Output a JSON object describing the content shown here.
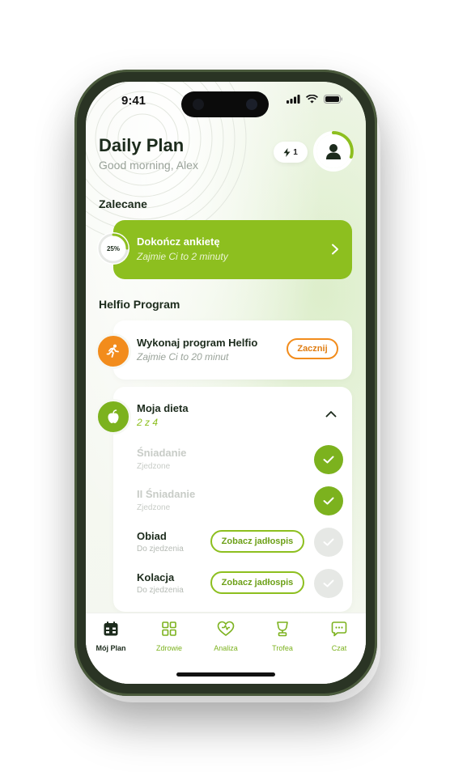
{
  "status_bar": {
    "time": "9:41"
  },
  "header": {
    "title": "Daily Plan",
    "greeting": "Good morning, Alex",
    "streak_count": "1"
  },
  "recommended": {
    "section_title": "Zalecane",
    "card": {
      "progress": "25%",
      "progress_fraction": 0.25,
      "title": "Dokończ ankietę",
      "subtitle": "Zajmie Ci to 2 minuty"
    }
  },
  "program": {
    "section_title": "Helfio Program",
    "task": {
      "title": "Wykonaj program Helfio",
      "subtitle": "Zajmie Ci to 20 minut",
      "button_label": "Zacznij"
    },
    "diet": {
      "title": "Moja dieta",
      "progress_text": "2 z 4",
      "meals": [
        {
          "name": "Śniadanie",
          "status": "Zjedzone",
          "done": true
        },
        {
          "name": "II Śniadanie",
          "status": "Zjedzone",
          "done": true
        },
        {
          "name": "Obiad",
          "status": "Do zjedzenia",
          "done": false,
          "button_label": "Zobacz jadłospis"
        },
        {
          "name": "Kolacja",
          "status": "Do zjedzenia",
          "done": false,
          "button_label": "Zobacz jadłospis"
        }
      ]
    }
  },
  "tabbar": {
    "items": [
      {
        "label": "Mój Plan",
        "icon": "calendar-icon",
        "active": true
      },
      {
        "label": "Zdrowie",
        "icon": "grid-icon",
        "active": false
      },
      {
        "label": "Analiza",
        "icon": "heart-icon",
        "active": false
      },
      {
        "label": "Trofea",
        "icon": "trophy-icon",
        "active": false
      },
      {
        "label": "Czat",
        "icon": "chat-icon",
        "active": false
      }
    ]
  },
  "colors": {
    "accent_green": "#8dbf1f",
    "accent_orange": "#f28c1c",
    "frame": "#2a3424"
  }
}
